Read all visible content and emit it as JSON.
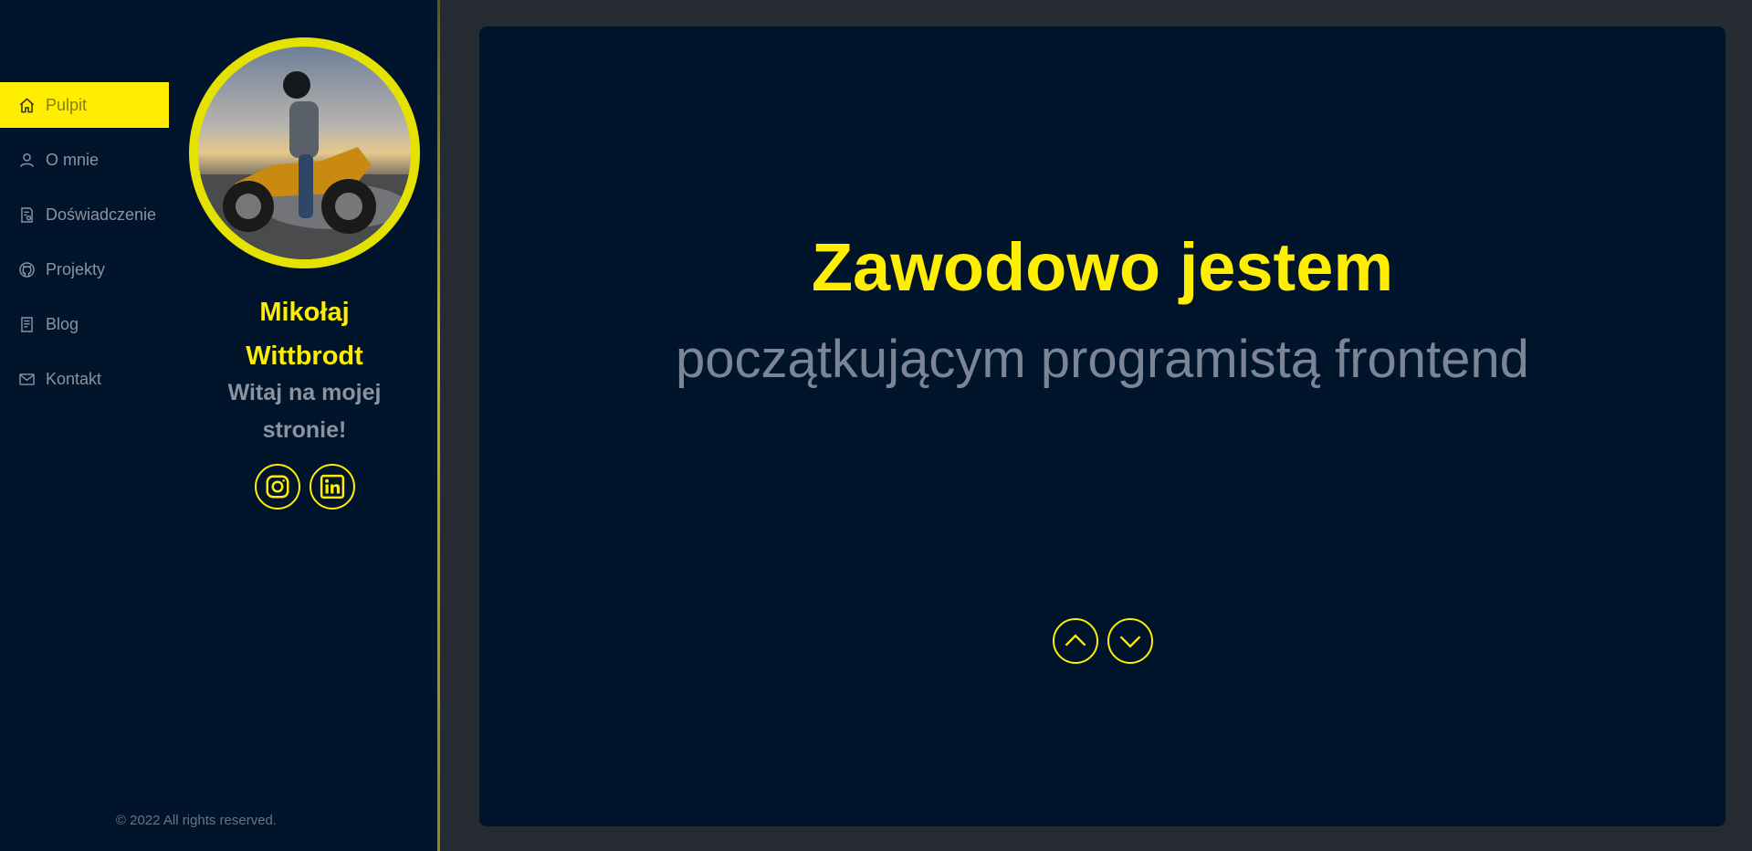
{
  "nav": {
    "items": [
      {
        "label": "Pulpit",
        "icon": "home-icon",
        "active": true
      },
      {
        "label": "O mnie",
        "icon": "user-icon",
        "active": false
      },
      {
        "label": "Doświadczenie",
        "icon": "document-icon",
        "active": false
      },
      {
        "label": "Projekty",
        "icon": "github-icon",
        "active": false
      },
      {
        "label": "Blog",
        "icon": "blog-icon",
        "active": false
      },
      {
        "label": "Kontakt",
        "icon": "mail-icon",
        "active": false
      }
    ]
  },
  "profile": {
    "name_line1": "Mikołaj",
    "name_line2": "Wittbrodt",
    "greeting_line1": "Witaj na mojej",
    "greeting_line2": "stronie!",
    "socials": [
      {
        "icon": "instagram-icon"
      },
      {
        "icon": "linkedin-icon"
      }
    ]
  },
  "footer": {
    "copyright": "© 2022 All rights reserved."
  },
  "main": {
    "headline": "Zawodowo jestem",
    "subheadline": "początkującym programistą frontend",
    "arrows": [
      {
        "icon": "chevron-up-icon"
      },
      {
        "icon": "chevron-down-icon"
      }
    ]
  },
  "colors": {
    "accent": "#ffee00",
    "background": "#00142b",
    "page": "#262a33",
    "muted_text": "#8b93a1"
  }
}
